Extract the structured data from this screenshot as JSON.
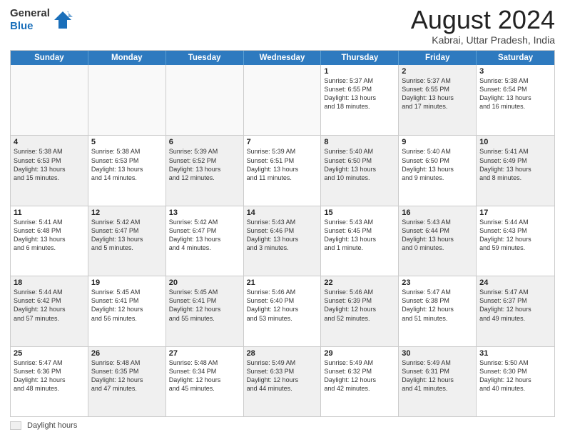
{
  "header": {
    "logo_line1": "General",
    "logo_line2": "Blue",
    "month_title": "August 2024",
    "subtitle": "Kabrai, Uttar Pradesh, India"
  },
  "weekdays": [
    "Sunday",
    "Monday",
    "Tuesday",
    "Wednesday",
    "Thursday",
    "Friday",
    "Saturday"
  ],
  "legend": {
    "label": "Daylight hours",
    "box_color": "#f0f0f0"
  },
  "weeks": [
    [
      {
        "day": "",
        "info": "",
        "empty": true
      },
      {
        "day": "",
        "info": "",
        "empty": true
      },
      {
        "day": "",
        "info": "",
        "empty": true
      },
      {
        "day": "",
        "info": "",
        "empty": true
      },
      {
        "day": "1",
        "info": "Sunrise: 5:37 AM\nSunset: 6:55 PM\nDaylight: 13 hours\nand 18 minutes."
      },
      {
        "day": "2",
        "info": "Sunrise: 5:37 AM\nSunset: 6:55 PM\nDaylight: 13 hours\nand 17 minutes.",
        "shaded": true
      },
      {
        "day": "3",
        "info": "Sunrise: 5:38 AM\nSunset: 6:54 PM\nDaylight: 13 hours\nand 16 minutes."
      }
    ],
    [
      {
        "day": "4",
        "info": "Sunrise: 5:38 AM\nSunset: 6:53 PM\nDaylight: 13 hours\nand 15 minutes.",
        "shaded": true
      },
      {
        "day": "5",
        "info": "Sunrise: 5:38 AM\nSunset: 6:53 PM\nDaylight: 13 hours\nand 14 minutes."
      },
      {
        "day": "6",
        "info": "Sunrise: 5:39 AM\nSunset: 6:52 PM\nDaylight: 13 hours\nand 12 minutes.",
        "shaded": true
      },
      {
        "day": "7",
        "info": "Sunrise: 5:39 AM\nSunset: 6:51 PM\nDaylight: 13 hours\nand 11 minutes."
      },
      {
        "day": "8",
        "info": "Sunrise: 5:40 AM\nSunset: 6:50 PM\nDaylight: 13 hours\nand 10 minutes.",
        "shaded": true
      },
      {
        "day": "9",
        "info": "Sunrise: 5:40 AM\nSunset: 6:50 PM\nDaylight: 13 hours\nand 9 minutes."
      },
      {
        "day": "10",
        "info": "Sunrise: 5:41 AM\nSunset: 6:49 PM\nDaylight: 13 hours\nand 8 minutes.",
        "shaded": true
      }
    ],
    [
      {
        "day": "11",
        "info": "Sunrise: 5:41 AM\nSunset: 6:48 PM\nDaylight: 13 hours\nand 6 minutes."
      },
      {
        "day": "12",
        "info": "Sunrise: 5:42 AM\nSunset: 6:47 PM\nDaylight: 13 hours\nand 5 minutes.",
        "shaded": true
      },
      {
        "day": "13",
        "info": "Sunrise: 5:42 AM\nSunset: 6:47 PM\nDaylight: 13 hours\nand 4 minutes."
      },
      {
        "day": "14",
        "info": "Sunrise: 5:43 AM\nSunset: 6:46 PM\nDaylight: 13 hours\nand 3 minutes.",
        "shaded": true
      },
      {
        "day": "15",
        "info": "Sunrise: 5:43 AM\nSunset: 6:45 PM\nDaylight: 13 hours\nand 1 minute."
      },
      {
        "day": "16",
        "info": "Sunrise: 5:43 AM\nSunset: 6:44 PM\nDaylight: 13 hours\nand 0 minutes.",
        "shaded": true
      },
      {
        "day": "17",
        "info": "Sunrise: 5:44 AM\nSunset: 6:43 PM\nDaylight: 12 hours\nand 59 minutes."
      }
    ],
    [
      {
        "day": "18",
        "info": "Sunrise: 5:44 AM\nSunset: 6:42 PM\nDaylight: 12 hours\nand 57 minutes.",
        "shaded": true
      },
      {
        "day": "19",
        "info": "Sunrise: 5:45 AM\nSunset: 6:41 PM\nDaylight: 12 hours\nand 56 minutes."
      },
      {
        "day": "20",
        "info": "Sunrise: 5:45 AM\nSunset: 6:41 PM\nDaylight: 12 hours\nand 55 minutes.",
        "shaded": true
      },
      {
        "day": "21",
        "info": "Sunrise: 5:46 AM\nSunset: 6:40 PM\nDaylight: 12 hours\nand 53 minutes."
      },
      {
        "day": "22",
        "info": "Sunrise: 5:46 AM\nSunset: 6:39 PM\nDaylight: 12 hours\nand 52 minutes.",
        "shaded": true
      },
      {
        "day": "23",
        "info": "Sunrise: 5:47 AM\nSunset: 6:38 PM\nDaylight: 12 hours\nand 51 minutes."
      },
      {
        "day": "24",
        "info": "Sunrise: 5:47 AM\nSunset: 6:37 PM\nDaylight: 12 hours\nand 49 minutes.",
        "shaded": true
      }
    ],
    [
      {
        "day": "25",
        "info": "Sunrise: 5:47 AM\nSunset: 6:36 PM\nDaylight: 12 hours\nand 48 minutes."
      },
      {
        "day": "26",
        "info": "Sunrise: 5:48 AM\nSunset: 6:35 PM\nDaylight: 12 hours\nand 47 minutes.",
        "shaded": true
      },
      {
        "day": "27",
        "info": "Sunrise: 5:48 AM\nSunset: 6:34 PM\nDaylight: 12 hours\nand 45 minutes."
      },
      {
        "day": "28",
        "info": "Sunrise: 5:49 AM\nSunset: 6:33 PM\nDaylight: 12 hours\nand 44 minutes.",
        "shaded": true
      },
      {
        "day": "29",
        "info": "Sunrise: 5:49 AM\nSunset: 6:32 PM\nDaylight: 12 hours\nand 42 minutes."
      },
      {
        "day": "30",
        "info": "Sunrise: 5:49 AM\nSunset: 6:31 PM\nDaylight: 12 hours\nand 41 minutes.",
        "shaded": true
      },
      {
        "day": "31",
        "info": "Sunrise: 5:50 AM\nSunset: 6:30 PM\nDaylight: 12 hours\nand 40 minutes."
      }
    ]
  ]
}
